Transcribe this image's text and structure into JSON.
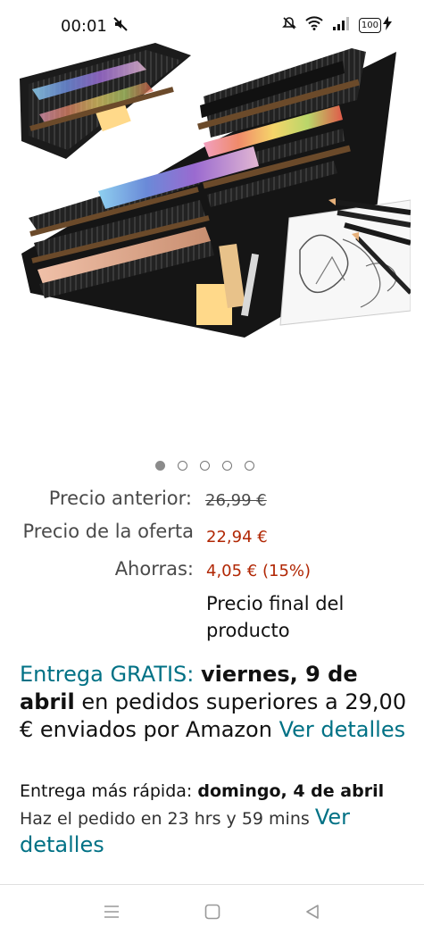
{
  "status_bar": {
    "time": "00:01",
    "battery": "100",
    "icons": [
      "mute-icon",
      "alarm-off-icon",
      "wifi-icon",
      "signal-icon",
      "battery-icon",
      "charging-icon"
    ]
  },
  "carousel": {
    "count": 5,
    "active_index": 0
  },
  "pricing": {
    "previous_label": "Precio anterior:",
    "previous_value": "26,99 €",
    "offer_label": "Precio de la oferta",
    "offer_value": "22,94 €",
    "savings_label": "Ahorras:",
    "savings_value": "4,05 € (15%)",
    "final_note": "Precio final del producto"
  },
  "delivery": {
    "free_label": "Entrega GRATIS:",
    "date": "viernes, 9 de abril",
    "conditions": "en pedidos superiores a 29,00 € enviados por Amazon",
    "details_link": "Ver detalles"
  },
  "fast_delivery": {
    "label": "Entrega más rápida:",
    "date": "domingo, 4 de abril",
    "order_within": "Haz el pedido en 23 hrs y 59 mins",
    "details_link": "Ver detalles"
  },
  "colors": {
    "price_red": "#b12704",
    "link_teal": "#007185"
  }
}
